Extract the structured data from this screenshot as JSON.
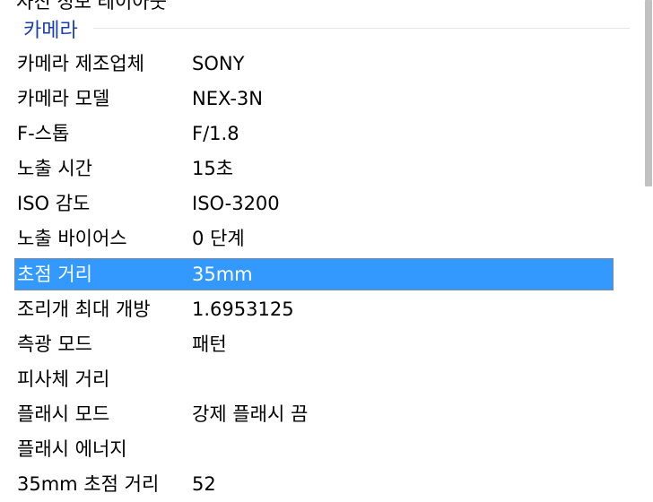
{
  "partial_row": {
    "name": "사진 정보 레이아웃",
    "value": ""
  },
  "section": {
    "title": "카메라"
  },
  "rows": [
    {
      "name": "카메라 제조업체",
      "value": "SONY",
      "selected": false
    },
    {
      "name": "카메라 모델",
      "value": "NEX-3N",
      "selected": false
    },
    {
      "name": "F-스톱",
      "value": "F/1.8",
      "selected": false
    },
    {
      "name": "노출 시간",
      "value": "15초",
      "selected": false
    },
    {
      "name": "ISO 감도",
      "value": "ISO-3200",
      "selected": false
    },
    {
      "name": "노출 바이어스",
      "value": "0 단계",
      "selected": false
    },
    {
      "name": "초점 거리",
      "value": "35mm",
      "selected": true
    },
    {
      "name": "조리개 최대 개방",
      "value": "1.6953125",
      "selected": false
    },
    {
      "name": "측광 모드",
      "value": "패턴",
      "selected": false
    },
    {
      "name": "피사체 거리",
      "value": "",
      "selected": false
    },
    {
      "name": "플래시 모드",
      "value": "강제 플래시 끔",
      "selected": false
    },
    {
      "name": "플래시 에너지",
      "value": "",
      "selected": false
    },
    {
      "name": "35mm 초점 거리",
      "value": "52",
      "selected": false
    }
  ],
  "colors": {
    "selection": "#3399ff",
    "section_title": "#1f3fa3"
  }
}
